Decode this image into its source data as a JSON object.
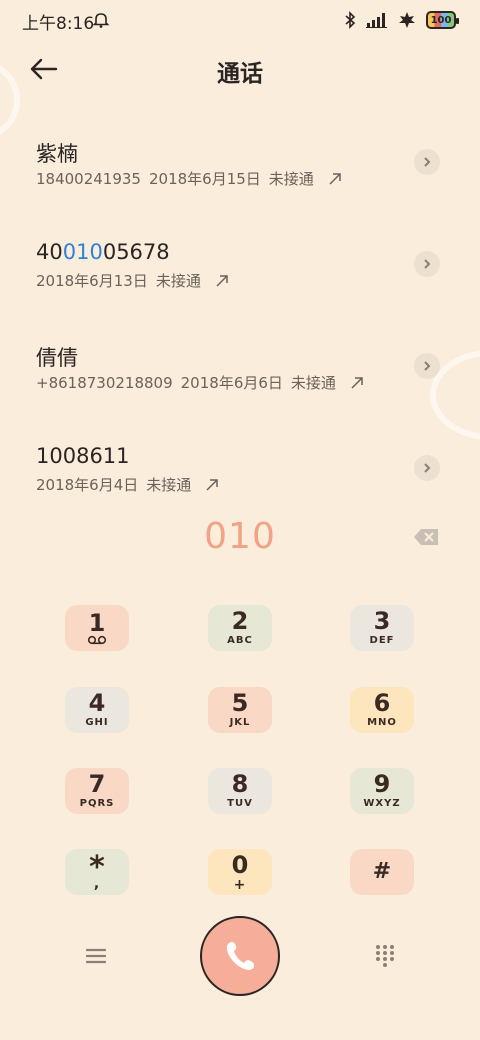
{
  "status_bar": {
    "time": "上午8:16",
    "battery": "100"
  },
  "header": {
    "title": "通话"
  },
  "calls": [
    {
      "name_pre": "紫楠",
      "name_hl": "",
      "name_post": "",
      "number": "18400241935",
      "date": "2018年6月15日",
      "status": "未接通"
    },
    {
      "name_pre": "40",
      "name_hl": "010",
      "name_post": "05678",
      "number": "",
      "date": "2018年6月13日",
      "status": "未接通"
    },
    {
      "name_pre": "倩倩",
      "name_hl": "",
      "name_post": "",
      "number": "+8618730218809",
      "date": "2018年6月6日",
      "status": "未接通"
    },
    {
      "name_pre": "1008611",
      "name_hl": "",
      "name_post": "",
      "number": "",
      "date": "2018年6月4日",
      "status": "未接通"
    }
  ],
  "dial": {
    "value": "010"
  },
  "keypad": {
    "keys": [
      {
        "digit": "1",
        "letters": "",
        "color": "#f9d9c6"
      },
      {
        "digit": "2",
        "letters": "ABC",
        "color": "#e6e7d5"
      },
      {
        "digit": "3",
        "letters": "DEF",
        "color": "#ebe7df"
      },
      {
        "digit": "4",
        "letters": "GHI",
        "color": "#ebe7df"
      },
      {
        "digit": "5",
        "letters": "JKL",
        "color": "#f9d9c6"
      },
      {
        "digit": "6",
        "letters": "MNO",
        "color": "#fde6bd"
      },
      {
        "digit": "7",
        "letters": "PQRS",
        "color": "#f9d9c6"
      },
      {
        "digit": "8",
        "letters": "TUV",
        "color": "#ebe7df"
      },
      {
        "digit": "9",
        "letters": "WXYZ",
        "color": "#e6e7d5"
      },
      {
        "digit": "*",
        "letters": ",",
        "color": "#e6e7d5"
      },
      {
        "digit": "0",
        "letters": "+",
        "color": "#fde6bd"
      },
      {
        "digit": "#",
        "letters": "",
        "color": "#f9d9c6"
      }
    ]
  },
  "icons": {
    "back": "arrow-left-icon",
    "voicemail": "voicemail-icon",
    "backspace": "backspace-icon",
    "menu": "menu-icon",
    "call": "phone-icon",
    "keypad_toggle": "dialpad-icon"
  },
  "colors": {
    "background": "#fbeddc",
    "highlight": "#2e82d6",
    "dial_text": "#f2a286",
    "call_button": "#f6ad99"
  }
}
